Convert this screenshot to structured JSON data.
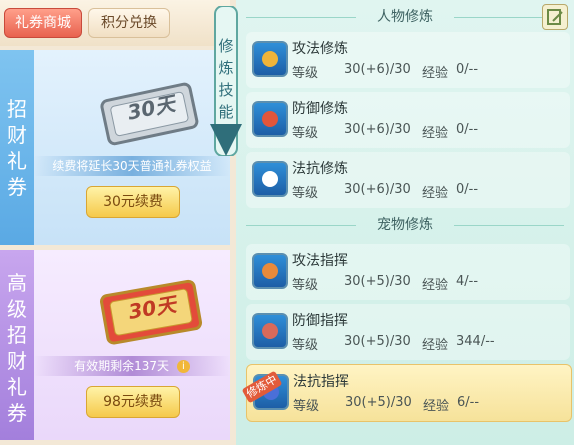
{
  "tabs": {
    "shop": "礼券商城",
    "points": "积分兑换"
  },
  "left": {
    "section_a_label": [
      "招",
      "财",
      "礼",
      "券"
    ],
    "section_b_label": [
      "高",
      "级",
      "招",
      "财",
      "礼",
      "券"
    ],
    "ticket_a_text": "30天",
    "ticket_b_text": "30天",
    "note_a": "续费将延长30天普通礼券权益",
    "note_b": "有效期剩余137天",
    "renew_a": "30元续费",
    "renew_b": "98元续费"
  },
  "scroll_tab": [
    "修",
    "炼",
    "技",
    "能"
  ],
  "panel": {
    "section_person": "人物修炼",
    "section_pet": "宠物修炼",
    "level_label": "等级",
    "exp_label": "经验",
    "badge": "修炼中",
    "person_skills": [
      {
        "name": "攻法修炼",
        "level": "30(+6)/30",
        "exp": "0/--",
        "icon": "attack-magic-icon",
        "color": "#f0b43a"
      },
      {
        "name": "防御修炼",
        "level": "30(+6)/30",
        "exp": "0/--",
        "icon": "defense-icon",
        "color": "#e2563b"
      },
      {
        "name": "法抗修炼",
        "level": "30(+6)/30",
        "exp": "0/--",
        "icon": "yin-yang-icon",
        "color": "#ffffff"
      }
    ],
    "pet_skills": [
      {
        "name": "攻法指挥",
        "level": "30(+5)/30",
        "exp": "4/--",
        "icon": "pet-attack-icon",
        "color": "#e98a3a"
      },
      {
        "name": "防御指挥",
        "level": "30(+5)/30",
        "exp": "344/--",
        "icon": "paw-icon",
        "color": "#d86a5a"
      },
      {
        "name": "法抗指挥",
        "level": "30(+5)/30",
        "exp": "6/--",
        "icon": "paw-shield-icon",
        "color": "#4a6fd8"
      }
    ]
  }
}
